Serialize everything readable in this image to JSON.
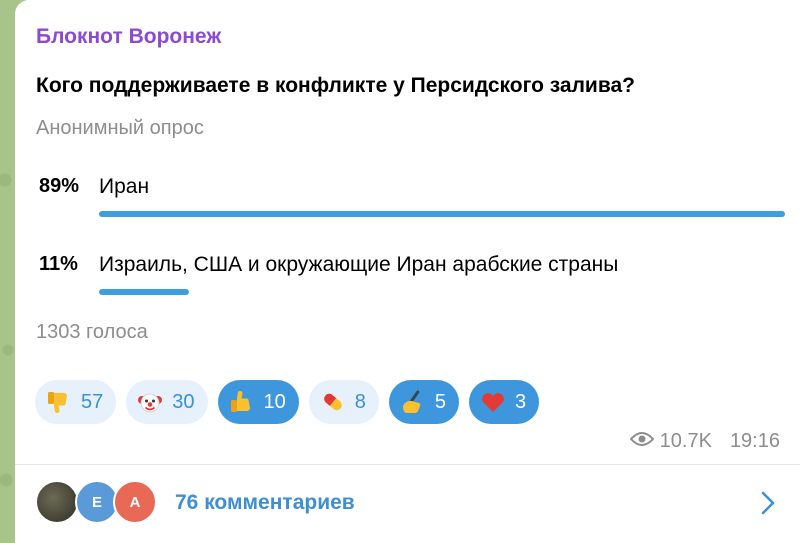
{
  "channel": {
    "name": "Блокнот Воронеж"
  },
  "poll": {
    "question": "Кого поддерживаете в конфликте у Персидского залива?",
    "type": "Анонимный опрос",
    "options": [
      {
        "percent": "89%",
        "label": "Иран",
        "fraction": 0.89
      },
      {
        "percent": "11%",
        "label": "Израиль, США и окружающие Иран арабские страны",
        "fraction": 0.11
      }
    ],
    "votes": "1303 голоса"
  },
  "reactions": [
    {
      "icon": "thumbs-down-icon",
      "count": "57",
      "style": "light"
    },
    {
      "icon": "clown-face-icon",
      "count": "30",
      "style": "light"
    },
    {
      "icon": "thumbs-up-icon",
      "count": "10",
      "style": "dark"
    },
    {
      "icon": "pill-icon",
      "count": "8",
      "style": "light"
    },
    {
      "icon": "writing-hand-icon",
      "count": "5",
      "style": "dark"
    },
    {
      "icon": "red-heart-icon",
      "count": "3",
      "style": "dark"
    }
  ],
  "meta": {
    "views": "10.7K",
    "time": "19:16"
  },
  "comments": {
    "avatars": [
      "",
      "E",
      "A"
    ],
    "label": "76 комментариев"
  },
  "colors": {
    "accent": "#3b9fe0",
    "channel": "#8c49d6",
    "muted": "#8d8d8d"
  }
}
